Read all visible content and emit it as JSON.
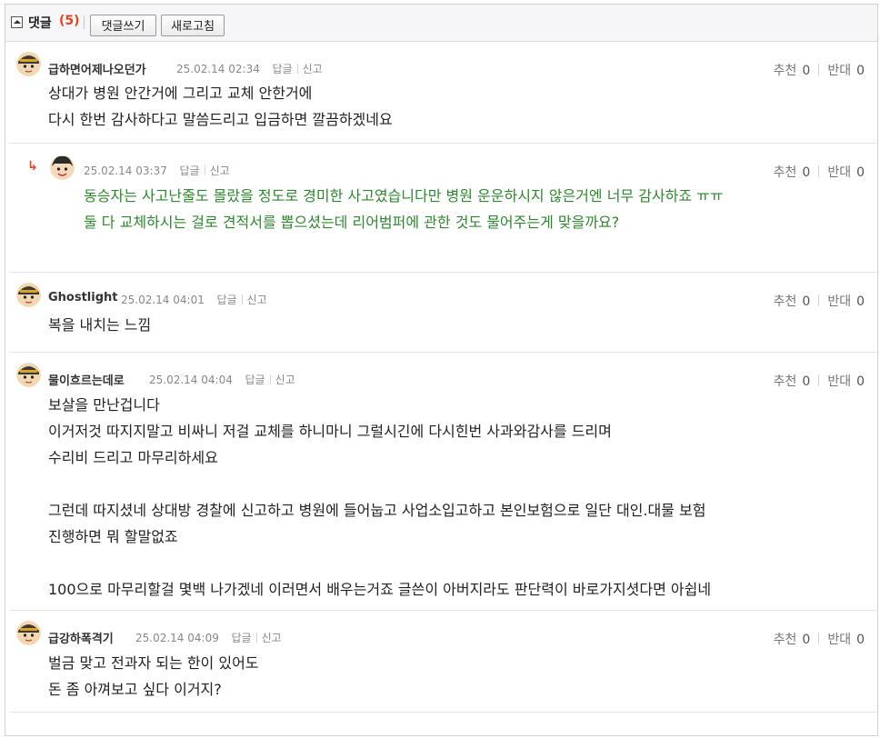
{
  "header": {
    "title": "댓글",
    "count": "(5)",
    "write_button": "댓글쓰기",
    "refresh_button": "새로고침"
  },
  "labels": {
    "reply": "답글",
    "report": "신고",
    "upvote": "추천",
    "downvote": "반대"
  },
  "comments": [
    {
      "nickname": "급하면어제나오던가",
      "date": "25.02.14 02:34",
      "up": "0",
      "down": "0",
      "lines": [
        "상대가 병원 안간거에 그리고 교체 안한거에",
        "다시 한번 감사하다고 말씀드리고 입금하면 깔끔하겠네요"
      ]
    },
    {
      "nickname": "",
      "is_reply": true,
      "reply_marker": "↳",
      "date": "25.02.14 03:37",
      "up": "0",
      "down": "0",
      "lines": [
        "동승자는 사고난줄도 몰랐을 정도로 경미한 사고였습니다만 병원 운운하시지 않은거엔 너무 감사하죠 ㅠㅠ",
        "둘 다 교체하시는 걸로 견적서를 뽑으셨는데 리어범퍼에 관한 것도 물어주는게 맞을까요?"
      ]
    },
    {
      "nickname": "Ghostlight",
      "date": "25.02.14 04:01",
      "up": "0",
      "down": "0",
      "lines": [
        "복을 내치는 느낌"
      ]
    },
    {
      "nickname": "물이흐르는데로",
      "date": "25.02.14 04:04",
      "up": "0",
      "down": "0",
      "lines": [
        "보살을 만난겁니다",
        "이거저것 따지지말고 비싸니 저걸 교체를 하니마니 그럴시긴에 다시힌번 사과와감사를 드리며",
        "수리비 드리고 마무리하세요",
        "",
        "그런데 따지셨네 상대방 경찰에 신고하고 병원에 들어눕고 사업소입고하고 본인보험으로 일단 대인.대물 보험",
        "진행하면 뭐 할말없죠",
        "",
        "100으로 마무리할걸 몇백 나가겠네 이러면서 배우는거죠 글쓴이 아버지라도 판단력이 바로가지셧다면 아쉽네"
      ]
    },
    {
      "nickname": "급강하폭격기",
      "date": "25.02.14 04:09",
      "up": "0",
      "down": "0",
      "lines": [
        "벌금 맞고 전과자 되는 한이 있어도",
        "돈 좀 아껴보고 싶다 이거지?"
      ]
    }
  ],
  "colors": {
    "accent": "#e8451e",
    "reply_text": "#2c8a2c",
    "header_bg": "#f6f6f8"
  }
}
